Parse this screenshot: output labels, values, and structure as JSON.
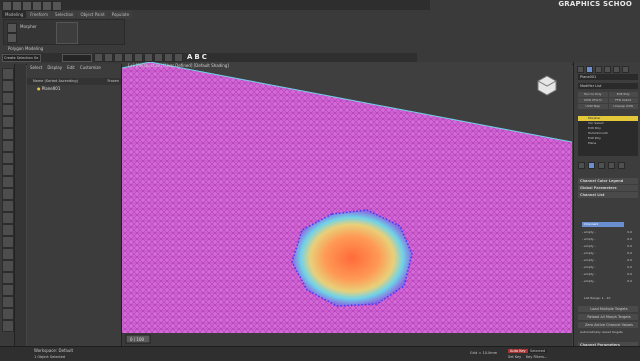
{
  "brand": "GRAPHICS SCHOO",
  "ribbon": {
    "tabs": [
      "Modeling",
      "Freeform",
      "Selection",
      "Object Paint",
      "Populate"
    ],
    "poly_label": "Polygon Modeling",
    "morpher_label": "Morpher",
    "selection_set": "Create Selection Se",
    "letters": [
      "A",
      "B",
      "C"
    ]
  },
  "scene_explorer": {
    "menu": [
      "Select",
      "Display",
      "Edit",
      "Customize"
    ],
    "header": "Name (Sorted Ascending)",
    "frozen": "Frozen",
    "item": "Plane001"
  },
  "viewport": {
    "label": "[+] [Perspective] [User Defined] [Default Shading]",
    "frame": "0 / 100"
  },
  "command_panel": {
    "object_name": "Plane001",
    "modifier_list": "Modifier List",
    "buttons": [
      "Turn to Poly",
      "Edit Poly",
      "UVW XForm",
      "FFD 2x2x2",
      "UVW Map",
      "Unwrap UVW"
    ],
    "stack": [
      "Morpher",
      "Vol. Select",
      "Edit Poly",
      "TurboSmooth",
      "Edit Poly",
      "Plane"
    ],
    "rollouts": [
      "Channel Color Legend",
      "Global Parameters",
      "Channel List"
    ],
    "channel_name": "Channel1",
    "channels": [
      "- empty -",
      "- empty -",
      "- empty -",
      "- empty -",
      "- empty -",
      "- empty -",
      "- empty -",
      "- empty -"
    ],
    "channel_values": [
      "0.0",
      "0.0",
      "0.0",
      "0.0",
      "0.0",
      "0.0",
      "0.0",
      "0.0"
    ],
    "list_range": "List Range: 1 - 10",
    "actions": [
      "Load Multiple Targets",
      "Reload All Morph Targets",
      "Zero Active Channel Values",
      "Automatically reload targets"
    ],
    "channel_params": "Channel Parameters"
  },
  "status": {
    "workspace": "Workspace: Default",
    "selected": "1 Object Selected",
    "grid": "Grid = 10.0mm",
    "autokey": "Auto Key",
    "selected_mode": "Selected",
    "set_key": "Set Key",
    "key_filters": "Key Filters..."
  },
  "colors": {
    "mesh": "#d46ad6",
    "mesh_line": "#b23db8",
    "selection_hot": "#ff8a4a",
    "selection_ring": "#6fd3e8",
    "vertex": "#3a3aff",
    "timeline_marker": "#d9d9d9"
  }
}
